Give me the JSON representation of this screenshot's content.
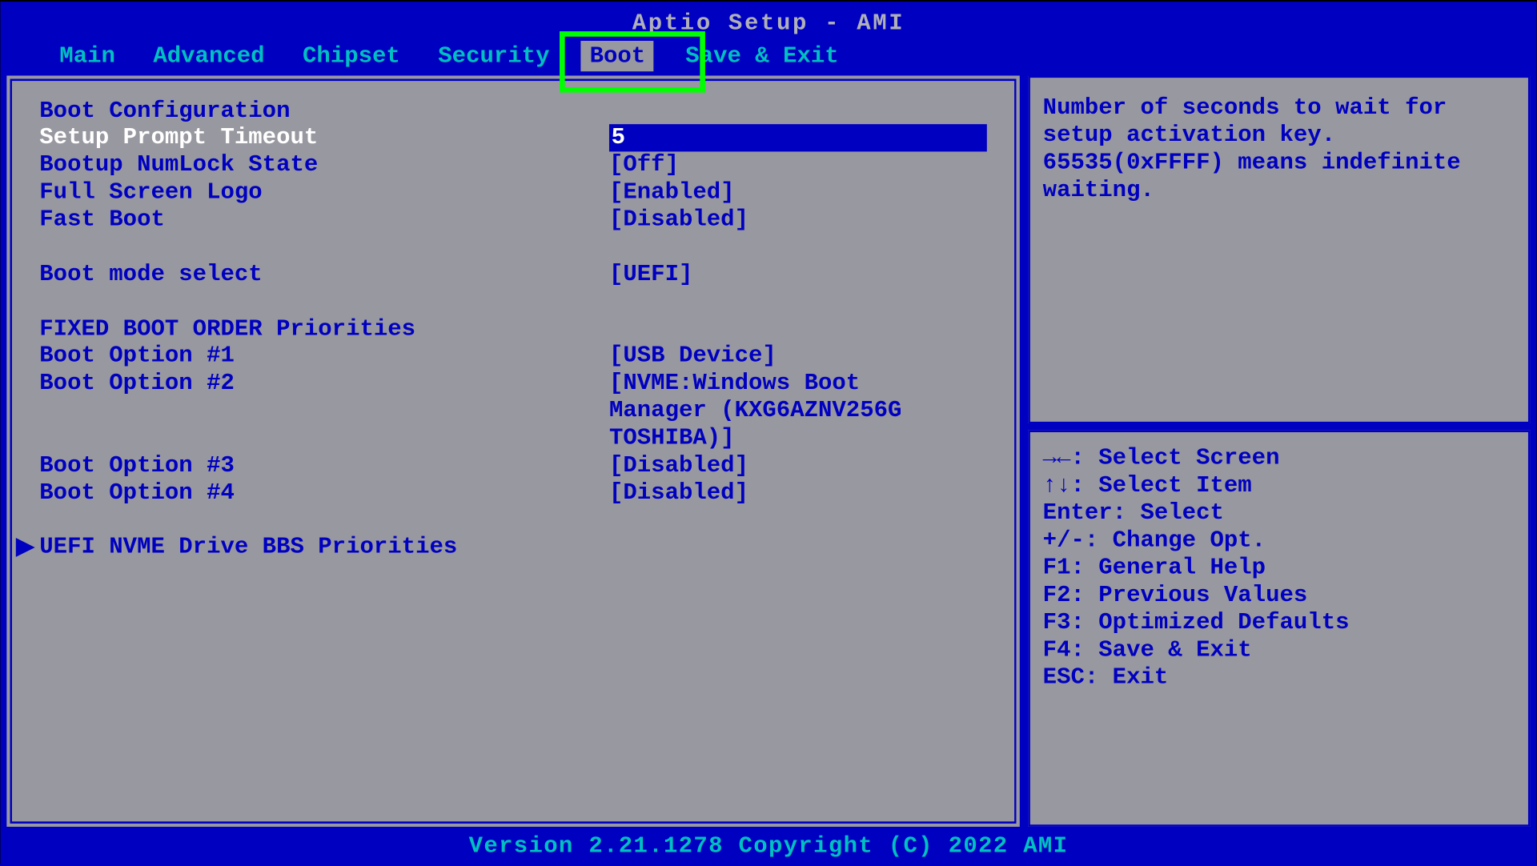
{
  "header": {
    "title": "Aptio Setup - AMI",
    "tabs": [
      "Main",
      "Advanced",
      "Chipset",
      "Security",
      "Boot",
      "Save & Exit"
    ],
    "active_tab": "Boot"
  },
  "left": {
    "section1_header": "Boot Configuration",
    "rows": [
      {
        "label": "Setup Prompt Timeout",
        "value": "5",
        "selected": true
      },
      {
        "label": "Bootup NumLock State",
        "value": "[Off]"
      },
      {
        "label": "Full Screen Logo",
        "value": "[Enabled]"
      },
      {
        "label": "Fast Boot",
        "value": "[Disabled]"
      }
    ],
    "boot_mode": {
      "label": "Boot mode select",
      "value": "[UEFI]"
    },
    "section2_header": "FIXED BOOT ORDER Priorities",
    "boot_options": [
      {
        "label": "Boot Option #1",
        "value": "[USB Device]"
      },
      {
        "label": "Boot Option #2",
        "value": "[NVME:Windows Boot Manager (KXG6AZNV256G TOSHIBA)]"
      },
      {
        "label": "Boot Option #3",
        "value": "[Disabled]"
      },
      {
        "label": "Boot Option #4",
        "value": "[Disabled]"
      }
    ],
    "submenu": "UEFI NVME Drive BBS Priorities"
  },
  "right": {
    "help_text": "Number of seconds to wait for setup activation key. 65535(0xFFFF) means indefinite waiting.",
    "keys": [
      "→←: Select Screen",
      "↑↓: Select Item",
      "Enter: Select",
      "+/-: Change Opt.",
      "F1: General Help",
      "F2: Previous Values",
      "F3: Optimized Defaults",
      "F4: Save & Exit",
      "ESC: Exit"
    ]
  },
  "footer": {
    "version": "Version 2.21.1278 Copyright (C) 2022 AMI"
  }
}
